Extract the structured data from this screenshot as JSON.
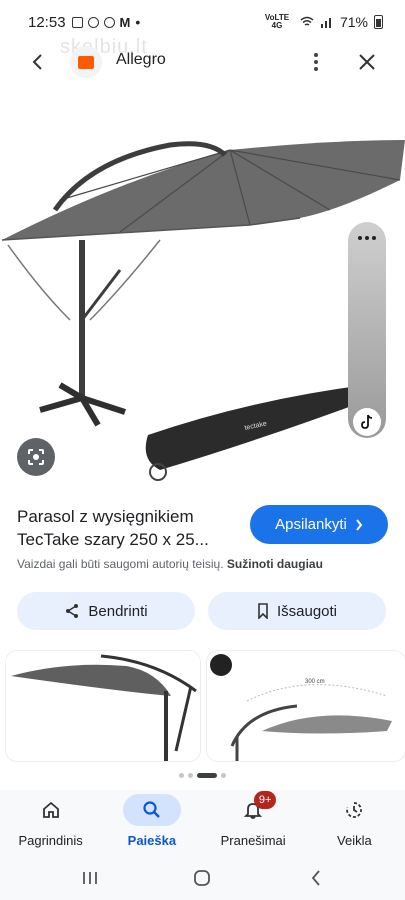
{
  "status_bar": {
    "time": "12:53",
    "dot": "•",
    "network": "VoLTE 4G",
    "battery": "71%",
    "icons": [
      "gallery-icon",
      "sun-icon",
      "key-icon",
      "mail-icon",
      "wifi-icon",
      "signal-icon",
      "battery-icon"
    ]
  },
  "watermark": "skelbiu.lt",
  "header": {
    "site_name": "Allegro",
    "brand_color": "#ff5a00"
  },
  "product": {
    "title_line1": "Parasol z wysięgnikiem",
    "title_line2": "TecTake szary 250 x 25...",
    "visit_label": "Apsilankyti",
    "copyright_text": "Vaizdai gali būti saugomi autorių teisių.",
    "learn_more": "Sužinoti daugiau",
    "bag_brand": "tectake"
  },
  "actions": {
    "share_label": "Bendrinti",
    "save_label": "Išsaugoti"
  },
  "related": {
    "dimension_label": "300 cm"
  },
  "bottom_nav": {
    "items": [
      {
        "label": "Pagrindinis",
        "icon": "home-icon",
        "active": false
      },
      {
        "label": "Paieška",
        "icon": "search-icon",
        "active": true
      },
      {
        "label": "Pranešimai",
        "icon": "bell-icon",
        "active": false,
        "badge": "9+"
      },
      {
        "label": "Veikla",
        "icon": "activity-icon",
        "active": false
      }
    ]
  },
  "colors": {
    "accent": "#1a73e8",
    "pill_bg": "#e8f0fe",
    "badge": "#b3261e",
    "active_nav": "#0b57d0"
  }
}
